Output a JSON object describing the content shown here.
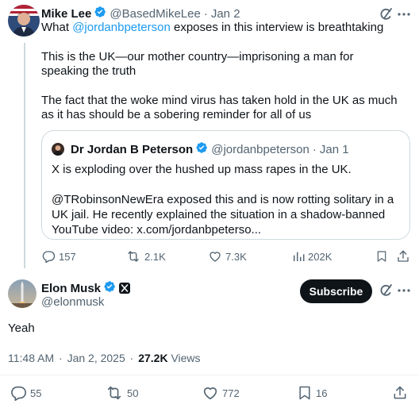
{
  "parent_tweet": {
    "author_name": "Mike Lee",
    "handle": "@BasedMikeLee",
    "separator": "·",
    "date": "Jan 2",
    "text_prefix": "What ",
    "mention": "@jordanbpeterson",
    "text_suffix": " exposes in this interview is breathtaking",
    "paragraph_2": "This is the UK—our mother country—imprisoning a man for speaking the truth",
    "paragraph_3": "The fact that the woke mind virus has taken hold in the UK as much as it has should be a sobering reminder for all of us",
    "quote": {
      "author_name": "Dr Jordan B Peterson",
      "handle": "@jordanbpeterson",
      "separator": "·",
      "date": "Jan 1",
      "paragraph_1": "X is exploding over the hushed up mass rapes in the UK.",
      "paragraph_2": "@TRobinsonNewEra exposed this and is now rotting solitary in a UK jail. He recently explained the situation in a shadow-banned YouTube video: x.com/jordanbpeterso..."
    },
    "stats": {
      "replies": "157",
      "reposts": "2.1K",
      "likes": "7.3K",
      "views": "202K"
    }
  },
  "main_tweet": {
    "author_name": "Elon Musk",
    "handle": "@elonmusk",
    "subscribe_label": "Subscribe",
    "text": "Yeah",
    "time": "11:48 AM",
    "separator": "·",
    "date": "Jan 2, 2025",
    "separator_2": "·",
    "views_count": "27.2K",
    "views_label": " Views",
    "stats": {
      "replies": "55",
      "reposts": "50",
      "likes": "772",
      "bookmarks": "16"
    }
  },
  "colors": {
    "accent": "#1d9bf0",
    "verified": "#1d9bf0",
    "muted": "#536471",
    "text": "#0f1419",
    "border": "#cfd9de"
  },
  "icons": [
    "grok-icon",
    "more-icon",
    "verified-badge-icon",
    "x-affiliate-icon",
    "reply-icon",
    "repost-icon",
    "like-icon",
    "views-icon",
    "bookmark-icon",
    "share-icon"
  ]
}
